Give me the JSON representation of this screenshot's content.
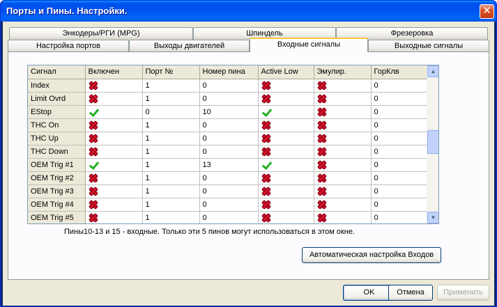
{
  "window": {
    "title": "Порты и Пины.   Настройки."
  },
  "tabs": {
    "row_back": [
      "Энкодеры/РГИ (MPG)",
      "Шпиндель",
      "Фрезеровка"
    ],
    "row_front": [
      "Настройка портов",
      "Выходы двигателей",
      "Входные сигналы",
      "Выходные сигналы"
    ],
    "active": "Входные сигналы"
  },
  "table": {
    "columns": [
      "Сигнал",
      "Включен",
      "Порт №",
      "Номер пина",
      "Active Low",
      "Эмулир.",
      "ГорКлв"
    ],
    "rows": [
      {
        "signal": "Index",
        "enabled": "x-icon",
        "port": "1",
        "pin": "0",
        "active_low": "x-icon",
        "emulated": "x-icon",
        "hotkey": "0"
      },
      {
        "signal": "Limit Ovrd",
        "enabled": "x-icon",
        "port": "1",
        "pin": "0",
        "active_low": "x-icon",
        "emulated": "x-icon",
        "hotkey": "0"
      },
      {
        "signal": "EStop",
        "enabled": "check-icon",
        "port": "0",
        "pin": "10",
        "active_low": "check-icon",
        "emulated": "x-icon",
        "hotkey": "0"
      },
      {
        "signal": "THC On",
        "enabled": "x-icon",
        "port": "1",
        "pin": "0",
        "active_low": "x-icon",
        "emulated": "x-icon",
        "hotkey": "0"
      },
      {
        "signal": "THC Up",
        "enabled": "x-icon",
        "port": "1",
        "pin": "0",
        "active_low": "x-icon",
        "emulated": "x-icon",
        "hotkey": "0"
      },
      {
        "signal": "THC Down",
        "enabled": "x-icon",
        "port": "1",
        "pin": "0",
        "active_low": "x-icon",
        "emulated": "x-icon",
        "hotkey": "0"
      },
      {
        "signal": "OEM Trig #1",
        "enabled": "check-icon",
        "port": "1",
        "pin": "13",
        "active_low": "check-icon",
        "emulated": "x-icon",
        "hotkey": "0"
      },
      {
        "signal": "OEM Trig #2",
        "enabled": "x-icon",
        "port": "1",
        "pin": "0",
        "active_low": "x-icon",
        "emulated": "x-icon",
        "hotkey": "0"
      },
      {
        "signal": "OEM Trig #3",
        "enabled": "x-icon",
        "port": "1",
        "pin": "0",
        "active_low": "x-icon",
        "emulated": "x-icon",
        "hotkey": "0"
      },
      {
        "signal": "OEM Trig #4",
        "enabled": "x-icon",
        "port": "1",
        "pin": "0",
        "active_low": "x-icon",
        "emulated": "x-icon",
        "hotkey": "0"
      },
      {
        "signal": "OEM Trig #5",
        "enabled": "x-icon",
        "port": "1",
        "pin": "0",
        "active_low": "x-icon",
        "emulated": "x-icon",
        "hotkey": "0"
      }
    ]
  },
  "info_text": "Пины10-13 и 15 - входные. Только эти 5 пинов могут использоваться в этом окне.",
  "buttons": {
    "auto_setup": "Автоматическая настройка Входов",
    "ok": "OK",
    "cancel": "Отмена",
    "apply": "Применить"
  },
  "colors": {
    "title_bar": "#0055e5",
    "x_mark": "#d0102a",
    "check_mark": "#22b022",
    "active_tab_accent": "#ffc83c"
  }
}
